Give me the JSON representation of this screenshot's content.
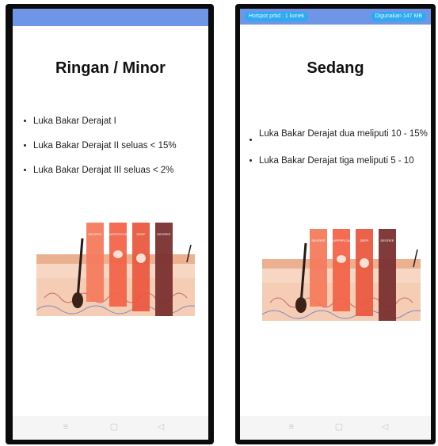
{
  "left_screen": {
    "title": "Ringan / Minor",
    "bullets": [
      "Luka Bakar Derajat I",
      "Luka Bakar Derajat II seluas < 15%",
      "Luka Bakar Derajat III seluas < 2%"
    ]
  },
  "right_screen": {
    "status": {
      "hotspot": "Hotspot prbd : 1 konek",
      "usage": "Digunakan 147 MB"
    },
    "title": "Sedang",
    "bullets": [
      "Luka Bakar Derajat dua meliputi 10 - 15%",
      "Luka Bakar Derajat tiga meliputi 5 - 10"
    ]
  },
  "illustration": {
    "degree_labels": [
      "1st DEGREE",
      "2nd SUPERFICIAL DEGREE",
      "2nd DEEP DEGREE",
      "3rd DEGREE"
    ]
  },
  "navbar_icons": [
    "menu-icon",
    "home-icon",
    "back-icon"
  ],
  "colors": {
    "statusbar": "#6f96e6",
    "pill": "#2eaaf0",
    "skin": "#f3c2a4",
    "burn_1": "#f57b5e",
    "burn_2a": "#f2644a",
    "burn_2b": "#ea5a40",
    "burn_3": "#7a3030"
  }
}
